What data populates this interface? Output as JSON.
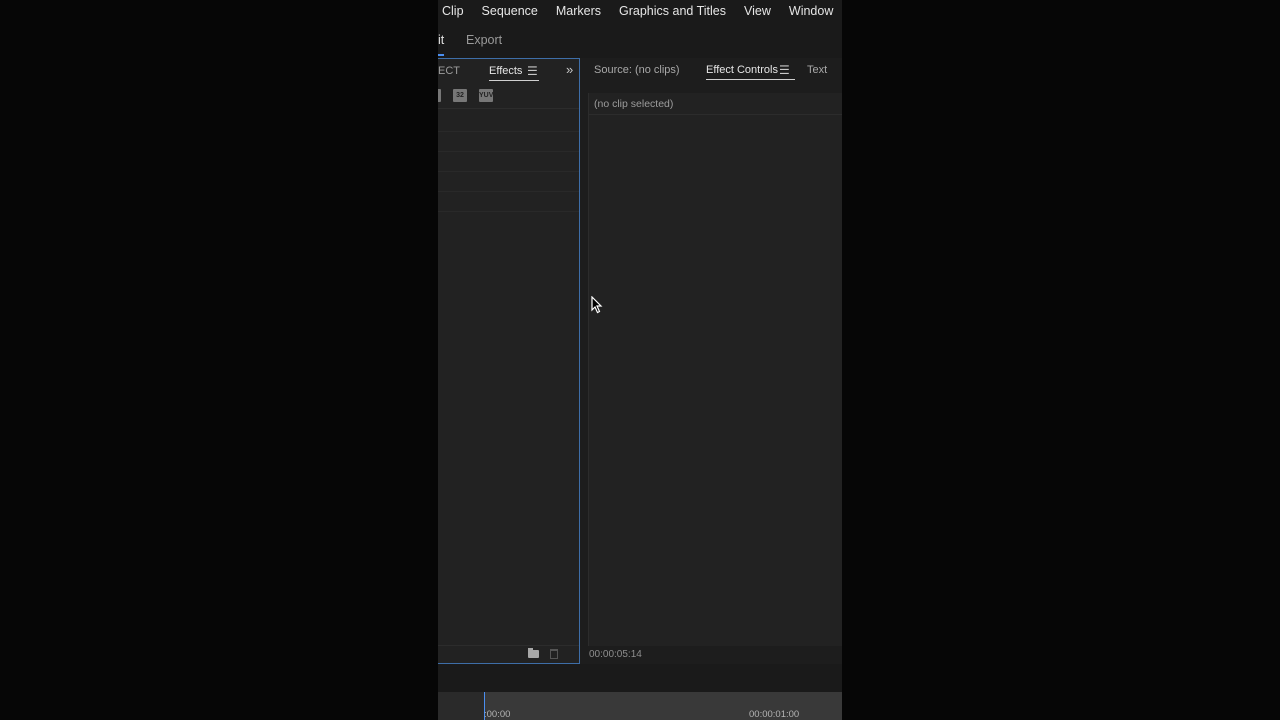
{
  "menu": [
    "Clip",
    "Sequence",
    "Markers",
    "Graphics and Titles",
    "View",
    "Window"
  ],
  "workspace": {
    "partial_tab": "it",
    "export_tab": "Export"
  },
  "left_panel": {
    "partial_tab": "ECT",
    "effects_tab": "Effects",
    "menu_icon": "☰",
    "overflow_icon": "»",
    "toolbar_icons": [
      {
        "name": "accelerated-effects-icon",
        "label": ""
      },
      {
        "name": "32-bit-icon",
        "label": "32"
      },
      {
        "name": "yuv-icon",
        "label": "YUV"
      }
    ]
  },
  "right_panel": {
    "source_tab": "Source: (no clips)",
    "effect_controls_tab": "Effect Controls",
    "menu_icon": "☰",
    "text_tab": "Text",
    "no_clip": "(no clip selected)",
    "timecode": "00:00:05:14"
  },
  "timeline": {
    "start": ":00:00",
    "end": "00:00:01:00"
  },
  "colors": {
    "accent": "#4a8ef0",
    "panel_border": "#3e6ea8",
    "background": "#1d1d1d"
  }
}
